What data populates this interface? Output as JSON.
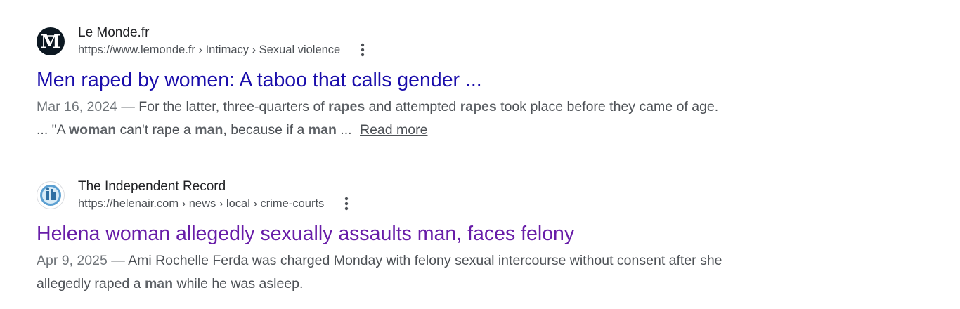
{
  "results": [
    {
      "site_name": "Le Monde.fr",
      "url": "https://www.lemonde.fr › Intimacy › Sexual violence",
      "favicon": "le-monde-logo-icon",
      "title": "Men raped by women: A taboo that calls gender ...",
      "date": "Mar 16, 2024",
      "snippet_parts": [
        {
          "text": "For the latter, three-quarters of "
        },
        {
          "text": "rapes",
          "bold": true
        },
        {
          "text": " and attempted "
        },
        {
          "text": "rapes",
          "bold": true
        },
        {
          "text": " took place before they came of age. ... \"A "
        },
        {
          "text": "woman",
          "bold": true
        },
        {
          "text": " can't rape a "
        },
        {
          "text": "man",
          "bold": true
        },
        {
          "text": ", because if a "
        },
        {
          "text": "man",
          "bold": true
        },
        {
          "text": " ... "
        }
      ],
      "read_more": "Read more"
    },
    {
      "site_name": "The Independent Record",
      "url": "https://helenair.com › news › local › crime-courts",
      "favicon": "independent-record-logo-icon",
      "title": "Helena woman allegedly sexually assaults man, faces felony",
      "date": "Apr 9, 2025",
      "snippet_parts": [
        {
          "text": "Ami Rochelle Ferda was charged Monday with felony sexual intercourse without consent after she allegedly raped a "
        },
        {
          "text": "man",
          "bold": true
        },
        {
          "text": " while he was asleep."
        }
      ]
    }
  ],
  "date_separator": " — ",
  "colors": {
    "link_unvisited": "#1a0dab",
    "link_visited": "#681da8",
    "snippet_text": "#4d5156"
  }
}
